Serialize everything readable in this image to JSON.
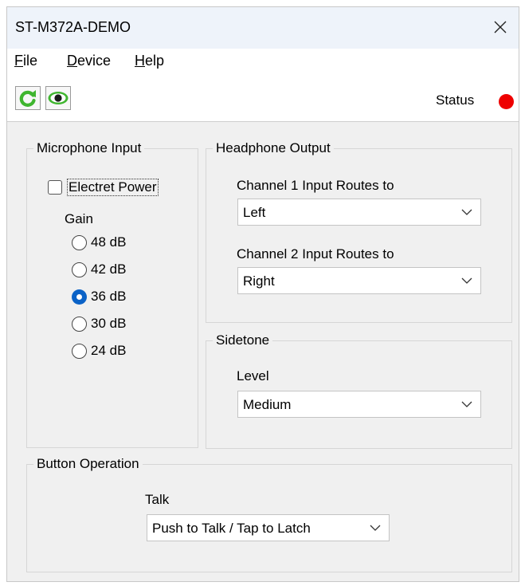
{
  "window": {
    "title": "ST-M372A-DEMO"
  },
  "menu": {
    "file": "File",
    "device": "Device",
    "help": "Help"
  },
  "toolbar": {
    "status_label": "Status",
    "status_color": "#ee0000"
  },
  "microphone": {
    "group_title": "Microphone Input",
    "electret_label": "Electret Power",
    "electret_checked": false,
    "gain_label": "Gain",
    "gain_options": [
      "48 dB",
      "42 dB",
      "36 dB",
      "30 dB",
      "24 dB"
    ],
    "gain_selected": "36 dB"
  },
  "headphone": {
    "group_title": "Headphone Output",
    "ch1_label": "Channel 1 Input Routes to",
    "ch1_value": "Left",
    "ch2_label": "Channel 2 Input Routes to",
    "ch2_value": "Right"
  },
  "sidetone": {
    "group_title": "Sidetone",
    "level_label": "Level",
    "level_value": "Medium"
  },
  "button_operation": {
    "group_title": "Button Operation",
    "talk_label": "Talk",
    "talk_value": "Push to Talk / Tap to Latch"
  },
  "colors": {
    "accent": "#0a62c7",
    "refresh_green": "#3fb52f",
    "eye_green": "#3fb52f"
  },
  "icons": {
    "refresh": "refresh-icon",
    "monitor": "eye-icon",
    "close": "close-icon"
  }
}
